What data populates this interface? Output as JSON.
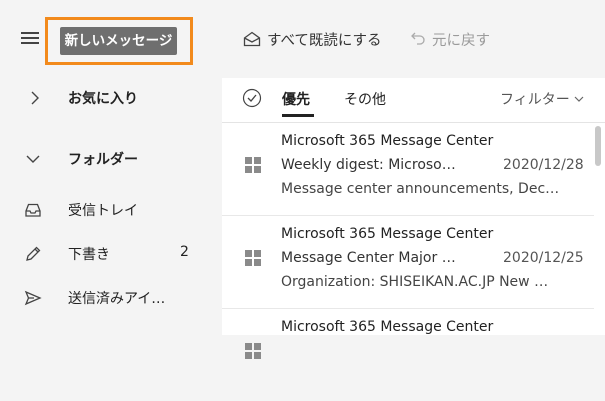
{
  "toolbar": {
    "new_message": "新しいメッセージ",
    "mark_all_read": "すべて既読にする",
    "undo": "元に戻す",
    "highlight_color": "#f28a1c"
  },
  "sidebar": {
    "favorites": "お気に入り",
    "folders": "フォルダー",
    "items": [
      {
        "label": "受信トレイ",
        "icon": "inbox-icon",
        "count": ""
      },
      {
        "label": "下書き",
        "icon": "pencil-icon",
        "count": "2"
      },
      {
        "label": "送信済みアイ…",
        "icon": "send-icon",
        "count": ""
      }
    ]
  },
  "tabs": {
    "focused": "優先",
    "other": "その他",
    "filter": "フィルター"
  },
  "messages": [
    {
      "sender": "Microsoft 365 Message Center",
      "subject": "Weekly digest: Microso…",
      "date": "2020/12/28",
      "preview": "Message center announcements, Dec…"
    },
    {
      "sender": "Microsoft 365 Message Center",
      "subject": "Message Center Major …",
      "date": "2020/12/25",
      "preview": "Organization: SHISEIKAN.AC.JP New …"
    },
    {
      "sender": "Microsoft 365 Message Center",
      "subject": "",
      "date": "",
      "preview": ""
    }
  ]
}
